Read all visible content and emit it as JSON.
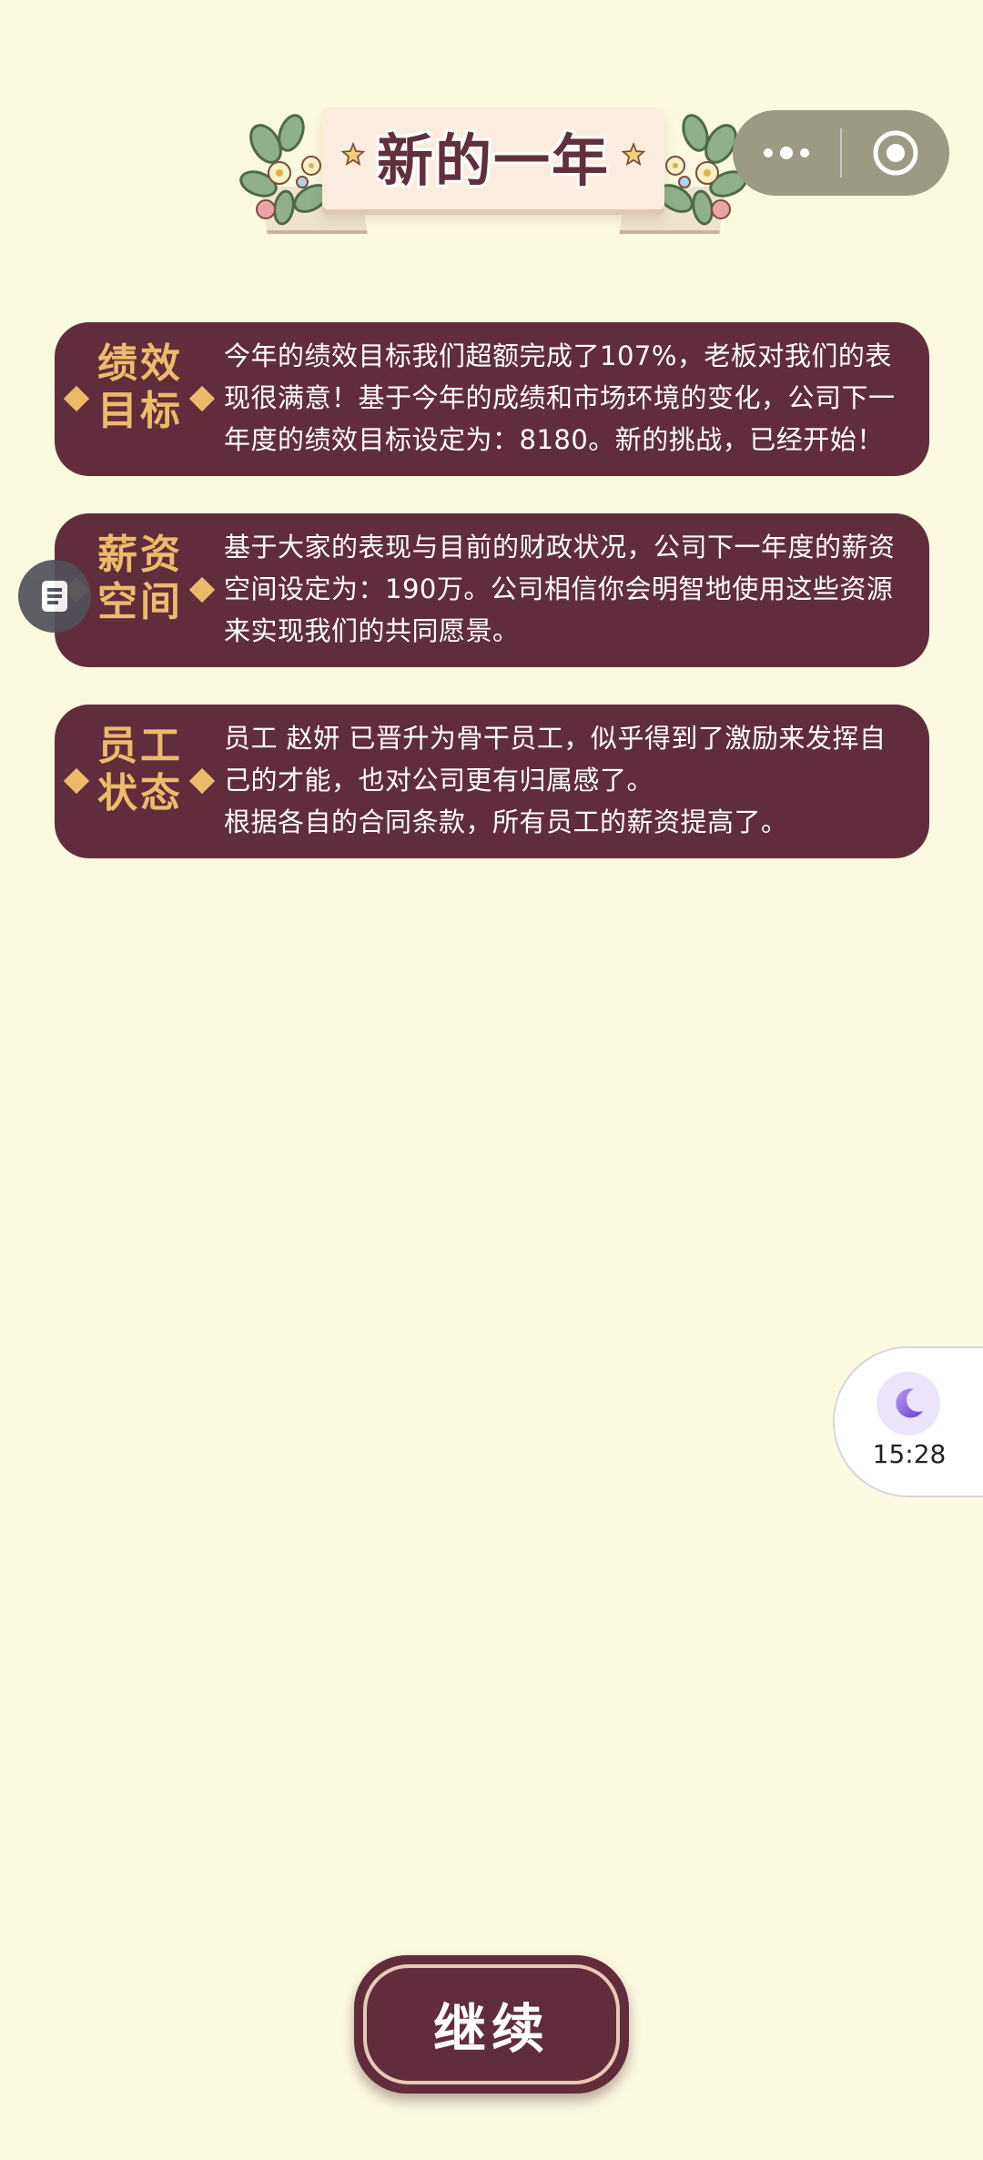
{
  "banner": {
    "title": "新的一年"
  },
  "capsule": {
    "more_icon": "more-dots-icon",
    "close_icon": "target-circle-icon"
  },
  "cards": [
    {
      "label": "绩效\n目标",
      "text": "今年的绩效目标我们超额完成了107%，老板对我们的表现很满意！基于今年的成绩和市场环境的变化，公司下一年度的绩效目标设定为：8180。新的挑战，已经开始！"
    },
    {
      "label": "薪资\n空间",
      "text": "基于大家的表现与目前的财政状况，公司下一年度的薪资空间设定为：190万。公司相信你会明智地使用这些资源来实现我们的共同愿景。"
    },
    {
      "label": "员工\n状态",
      "text": "员工 赵妍 已晋升为骨干员工，似乎得到了激励来发挥自己的才能，也对公司更有归属感了。\n根据各自的合同条款，所有员工的薪资提高了。"
    }
  ],
  "time_widget": {
    "time": "15:28",
    "icon": "moon-icon"
  },
  "continue_button": {
    "label": "继续"
  },
  "colors": {
    "background": "#fcf9e1",
    "card": "#612d3c",
    "label_gold": "#edba6c",
    "banner_bg": "#fbece0"
  }
}
